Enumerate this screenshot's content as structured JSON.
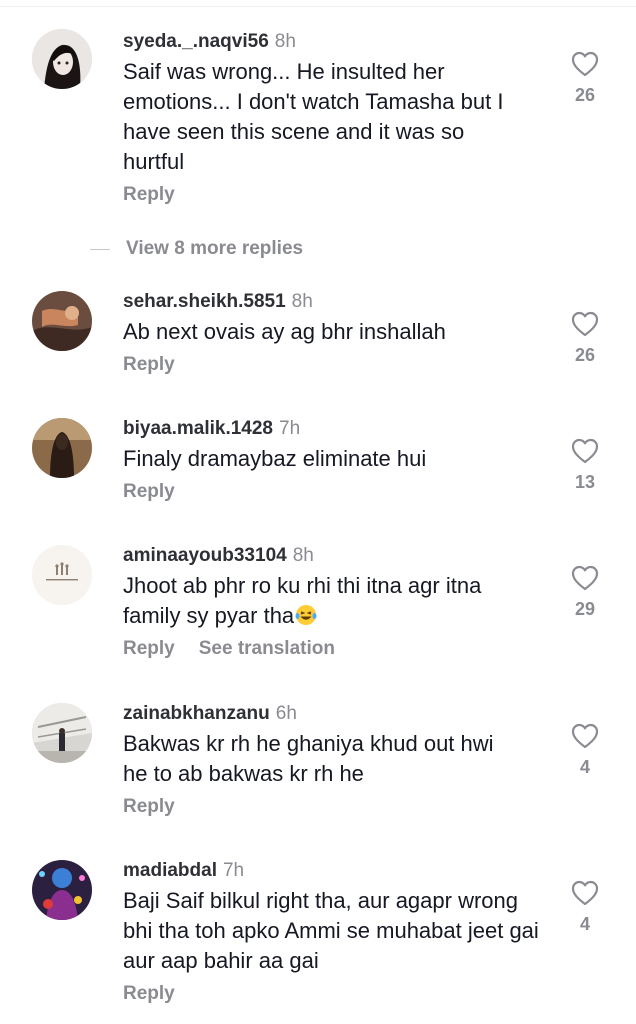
{
  "comments": [
    {
      "username": "syeda._.naqvi56",
      "time": "8h",
      "text": "Saif was wrong... He insulted her emotions... I don't watch Tamasha but I have seen this scene and it was so hurtful",
      "reply": "Reply",
      "likes": "26"
    },
    {
      "username": "sehar.sheikh.5851",
      "time": "8h",
      "text": "Ab next ovais ay ag bhr inshallah",
      "reply": "Reply",
      "likes": "26"
    },
    {
      "username": "biyaa.malik.1428",
      "time": "7h",
      "text": "Finaly dramaybaz eliminate hui",
      "reply": "Reply",
      "likes": "13"
    },
    {
      "username": "aminaayoub33104",
      "time": "8h",
      "text": "Jhoot ab phr ro ku rhi thi itna agr itna family sy pyar tha",
      "reply": "Reply",
      "see_translation": "See translation",
      "likes": "29"
    },
    {
      "username": "zainabkhanzanu",
      "time": "6h",
      "text": "Bakwas kr rh he ghaniya khud out hwi he to ab bakwas kr rh he",
      "reply": "Reply",
      "likes": "4"
    },
    {
      "username": "madiabdal",
      "time": "7h",
      "text": "Baji Saif bilkul right tha, aur agapr wrong bhi tha toh apko Ammi se muhabat jeet gai aur aap bahir aa gai",
      "reply": "Reply",
      "likes": "4"
    }
  ],
  "view_more_replies": "View 8 more replies",
  "icons": {
    "like": "heart-outline-icon",
    "emoji": "laughing-tears-emoji"
  },
  "colors": {
    "text": "#161823",
    "muted": "#8a8b91",
    "username": "#2f3035"
  }
}
